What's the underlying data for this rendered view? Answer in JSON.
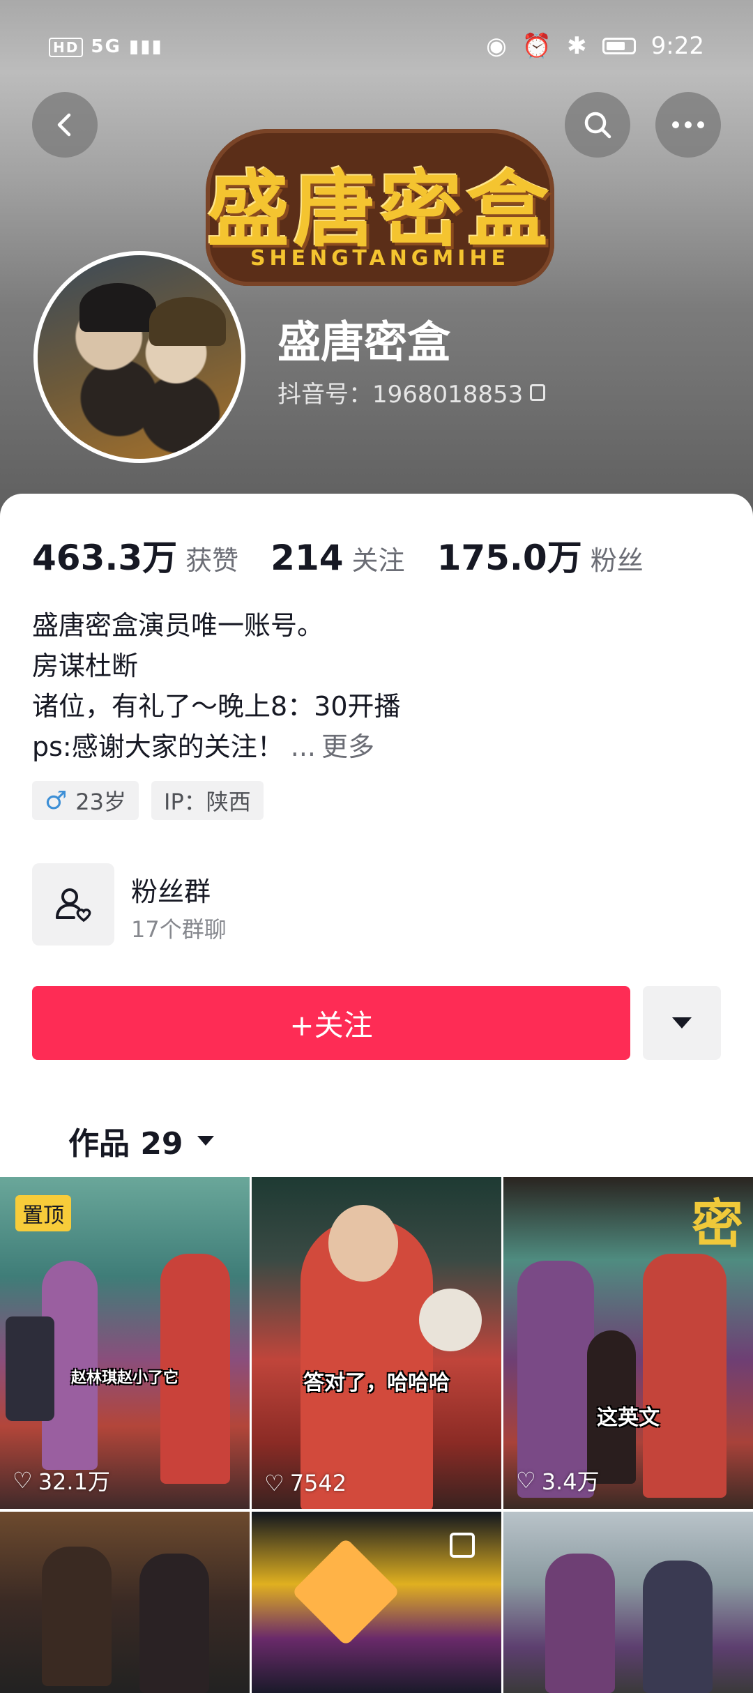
{
  "status_bar": {
    "network": "HD 5G",
    "time": "9:22"
  },
  "header": {
    "logo_text": "盛唐密盒",
    "logo_subtext": "SHENGTANGMIHE",
    "nickname": "盛唐密盒",
    "douyin_id": "抖音号：1968018853"
  },
  "stats": [
    {
      "value": "463.3万",
      "label": "获赞"
    },
    {
      "value": "214",
      "label": "关注"
    },
    {
      "value": "175.0万",
      "label": "粉丝"
    }
  ],
  "bio": {
    "lines": [
      "盛唐密盒演员唯一账号。",
      "房谋杜断",
      "诸位，有礼了～晚上8：30开播",
      "ps:感谢大家的关注！"
    ],
    "ellipsis": "...",
    "more": "更多"
  },
  "tags": {
    "age": "23岁",
    "ip": "IP：陕西"
  },
  "fans_group": {
    "title": "粉丝群",
    "subtitle": "17个群聊"
  },
  "follow_button": "+关注",
  "tabs": {
    "works": "作品 29"
  },
  "videos": [
    {
      "pinned_label": "置顶",
      "caption": "赵林琪赵小了它",
      "likes": "32.1万"
    },
    {
      "caption": "答对了，哈哈哈",
      "likes": "7542"
    },
    {
      "caption": "这英文",
      "likes": "3.4万",
      "overlay_text": "密"
    },
    {
      "caption": ""
    },
    {
      "caption": ""
    },
    {
      "caption": ""
    }
  ],
  "colors": {
    "follow": "#fe2c55",
    "pin": "#f7cc3a",
    "male": "#3d8fd6"
  }
}
